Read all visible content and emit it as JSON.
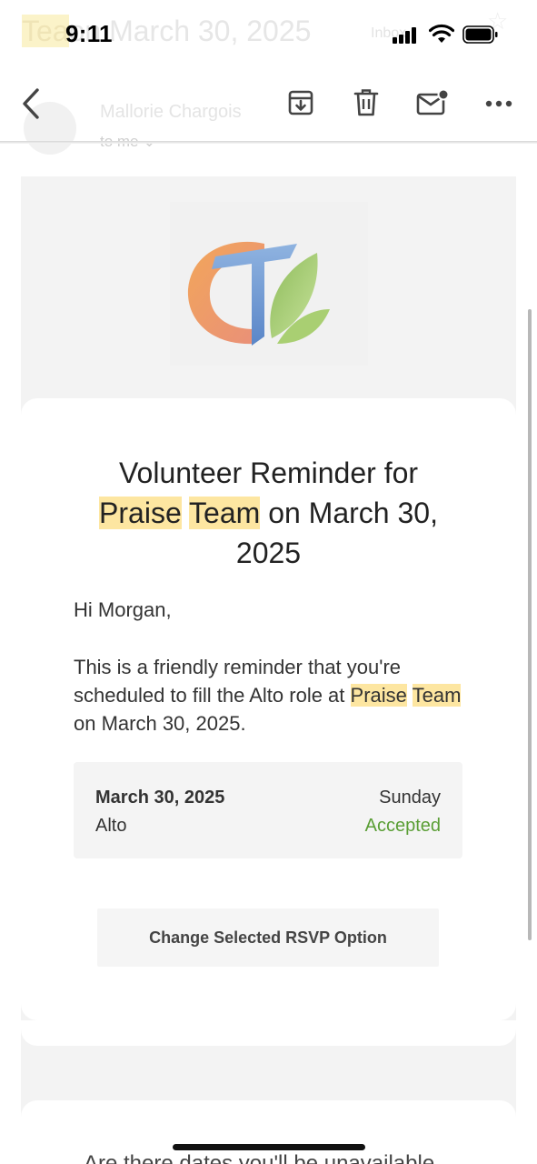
{
  "status_bar": {
    "time": "9:11"
  },
  "background_header": {
    "subject_start": "Tea",
    "subject_rest": "on March 30, 2025",
    "inbox_label": "Inbox",
    "sender_name": "Mallorie  Chargois",
    "recipient": "to me"
  },
  "toolbar": {
    "back_icon": "chevron-left-icon",
    "archive_icon": "archive-icon",
    "delete_icon": "trash-icon",
    "mark_unread_icon": "mail-unread-icon",
    "more_icon": "more-horizontal-icon"
  },
  "email": {
    "title_line1": "Volunteer Reminder for",
    "title_hl1": "Praise",
    "title_hl2": "Team",
    "title_after": "on March 30,",
    "title_line3": "2025",
    "greeting": "Hi Morgan,",
    "body_pre": "This is a friendly reminder that you're scheduled to fill the Alto role at ",
    "body_hl1": "Praise",
    "body_hl2": "Team",
    "body_post": " on March 30, 2025.",
    "detail": {
      "date": "March 30, 2025",
      "day": "Sunday",
      "role": "Alto",
      "status": "Accepted"
    },
    "rsvp_button": "Change Selected RSVP Option",
    "next_section_cut": "Are there dates you'll be unavailable"
  },
  "colors": {
    "highlight": "#fde6a1",
    "accepted": "#5a9e35",
    "mail_background": "#f3f3f3"
  }
}
